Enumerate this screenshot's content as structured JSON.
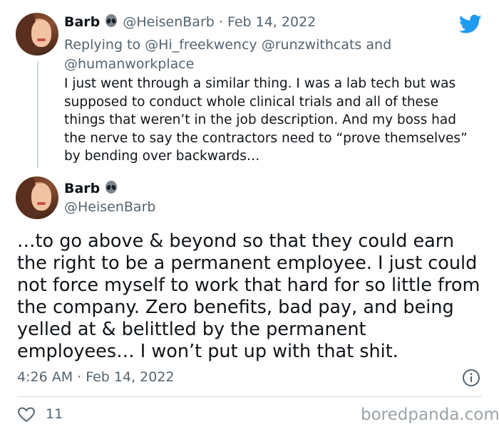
{
  "reply_tweet": {
    "display_name": "Barb",
    "emoji_icon": "alien-icon",
    "handle": "@HeisenBarb",
    "separator": "·",
    "date": "Feb 14, 2022",
    "replying_prefix": "Replying to",
    "replying_user_1": "@Hi_freekwency",
    "replying_user_2": "@runzwithcats",
    "replying_and": "and",
    "replying_user_3": "@humanworkplace",
    "text_lines": [
      "I just went through a similar thing. I was a lab tech but was",
      "supposed to conduct whole clinical trials and all of these",
      "things that weren’t in the job description. And my boss had",
      "the nerve to say the contractors need to “prove themselves”",
      "by bending over backwards…"
    ]
  },
  "main_tweet": {
    "display_name": "Barb",
    "emoji_icon": "alien-icon",
    "handle": "@HeisenBarb",
    "text_lines": [
      "…to go above & beyond so that they could earn",
      "the right to be a permanent employee. I just could",
      "not force myself to work that hard for so little from",
      "the company. Zero benefits, bad pay, and being",
      "yelled at & belittled by the permanent",
      "employees… I won’t put up with that shit."
    ],
    "timestamp": "4:26 AM · Feb 14, 2022",
    "like_count": "11"
  },
  "brand_icon": "twitter-bird-icon",
  "colors": {
    "twitter_blue": "#1d9bf0",
    "text": "#0f1419",
    "secondary": "#536471",
    "heart": "#536471"
  },
  "watermark": "boredpanda.com"
}
